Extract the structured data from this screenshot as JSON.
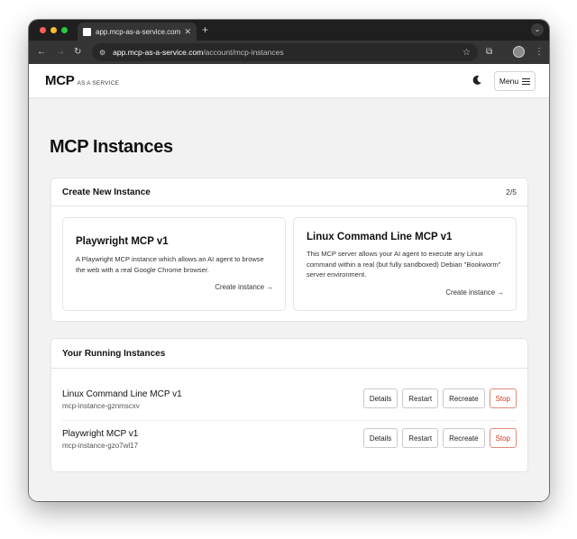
{
  "browser": {
    "tab": {
      "title": "app.mcp-as-a-service.com/a"
    },
    "new_tab": "+",
    "url_host": "app.mcp-as-a-service.com",
    "url_path": "/account/mcp-instances"
  },
  "header": {
    "logo_mark": "MCP",
    "logo_tag": "AS A SERVICE",
    "menu_label": "Menu"
  },
  "main": {
    "page_title": "MCP Instances",
    "create": {
      "heading": "Create New Instance",
      "count": "2/5",
      "templates": [
        {
          "title": "Playwright MCP v1",
          "description": "A Playwright MCP instance which allows an AI agent to browse the web with a real Google Chrome browser.",
          "link": "Create instance →"
        },
        {
          "title": "Linux Command Line MCP v1",
          "description": "This MCP server allows your AI agent to execute any Linux command within a real (but fully sandboxed) Debian \"Bookworm\" server environment.",
          "link": "Create instance →"
        }
      ]
    },
    "running": {
      "heading": "Your Running Instances",
      "instances": [
        {
          "name": "Linux Command Line MCP v1",
          "id": "mcp-instance-gznmscxv"
        },
        {
          "name": "Playwright MCP v1",
          "id": "mcp-instance-gzo7wl17"
        }
      ],
      "actions": {
        "details": "Details",
        "restart": "Restart",
        "recreate": "Recreate",
        "stop": "Stop"
      }
    }
  },
  "colors": {
    "stop": "#d3381c",
    "traffic_red": "#ff5f57",
    "traffic_yellow": "#febc2e",
    "traffic_green": "#28c840"
  }
}
